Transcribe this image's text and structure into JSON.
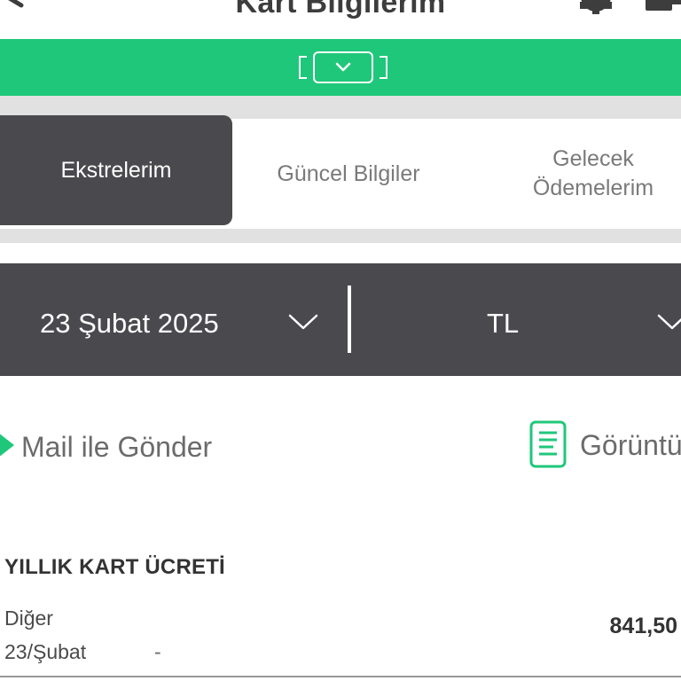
{
  "header": {
    "title": "Kart Bilgilerim",
    "back_icon": "back-arrow-icon",
    "settings_icon": "gear-icon",
    "logout_icon": "logout-icon"
  },
  "banner": {
    "color": "#1fc77a",
    "toggle_icon": "chevron-down-icon"
  },
  "tabs": [
    {
      "label": "Ekstrelerim",
      "active": true
    },
    {
      "label": "Güncel Bilgiler",
      "active": false
    },
    {
      "label": "Gelecek Ödemelerim",
      "active": false
    }
  ],
  "filters": {
    "date_value": "23 Şubat 2025",
    "currency_value": "TL"
  },
  "actions": {
    "mail_label": "Mail ile Gönder",
    "view_label": "Görüntüle"
  },
  "section": {
    "title": "YILLIK KART ÜCRETİ",
    "transactions": [
      {
        "description": "Diğer",
        "date": "23/Şubat",
        "installment": "-",
        "amount": "841,50"
      }
    ]
  },
  "colors": {
    "accent_green": "#1fc77a",
    "dark_panel": "#4a4a4e",
    "text": "#3a3a3a"
  }
}
